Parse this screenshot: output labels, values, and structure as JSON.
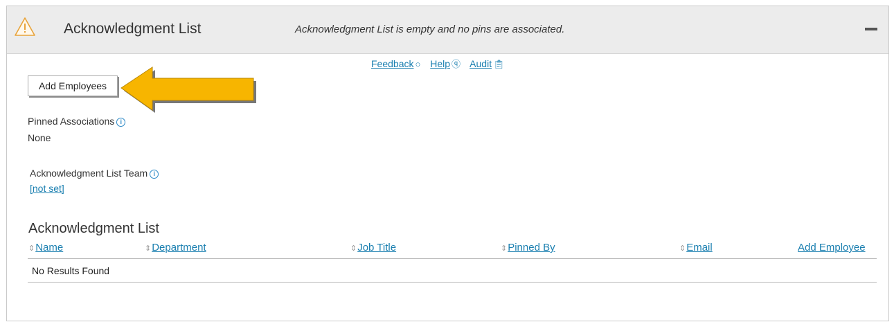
{
  "header": {
    "title": "Acknowledgment List",
    "message": "Acknowledgment List is empty and no pins are associated.",
    "warning_icon": "warning-triangle-icon",
    "collapse_icon": "minus-icon"
  },
  "links": {
    "feedback": "Feedback",
    "help": "Help",
    "audit": "Audit"
  },
  "add_employees_button": "Add Employees",
  "pinned_associations": {
    "label": "Pinned Associations",
    "value": "None"
  },
  "list_team": {
    "label": "Acknowledgment List Team",
    "value": "[not set]"
  },
  "table": {
    "title": "Acknowledgment List",
    "columns": [
      "Name",
      "Department",
      "Job Title",
      "Pinned By",
      "Email"
    ],
    "add_employee_link": "Add Employee",
    "empty_text": "No Results Found"
  },
  "colors": {
    "link": "#1a7fb0",
    "header_bg": "#ececec",
    "arrow_fill": "#f7b500",
    "warning": "#e8a33a"
  }
}
